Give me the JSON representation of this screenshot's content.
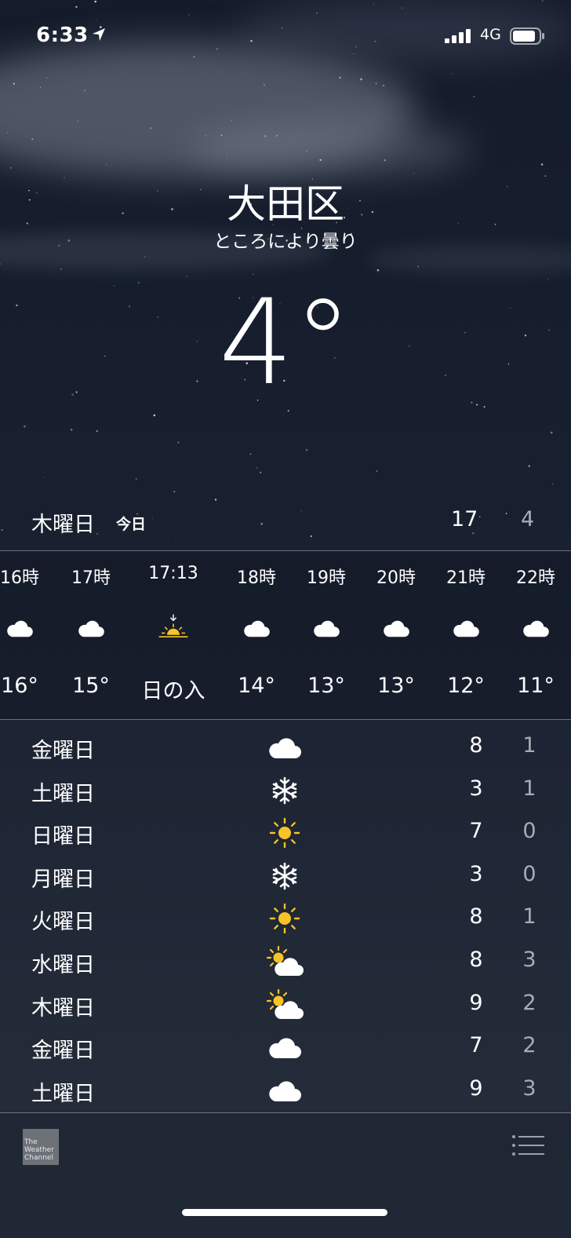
{
  "status_bar": {
    "time": "6:33",
    "network": "4G"
  },
  "location": {
    "city": "大田区",
    "condition": "ところにより曇り",
    "temperature": "4°"
  },
  "today": {
    "day": "木曜日",
    "label": "今日",
    "high": "17",
    "low": "4"
  },
  "hourly": [
    {
      "time": "16時",
      "icon": "cloud-icon",
      "value": "16°"
    },
    {
      "time": "17時",
      "icon": "cloud-icon",
      "value": "15°"
    },
    {
      "time": "17:13",
      "icon": "sunset-icon",
      "value": "日の入"
    },
    {
      "time": "18時",
      "icon": "cloud-icon",
      "value": "14°"
    },
    {
      "time": "19時",
      "icon": "cloud-icon",
      "value": "13°"
    },
    {
      "time": "20時",
      "icon": "cloud-icon",
      "value": "13°"
    },
    {
      "time": "21時",
      "icon": "cloud-icon",
      "value": "12°"
    },
    {
      "time": "22時",
      "icon": "cloud-icon",
      "value": "11°"
    }
  ],
  "daily": [
    {
      "day": "金曜日",
      "icon": "cloud-icon",
      "high": "8",
      "low": "1"
    },
    {
      "day": "土曜日",
      "icon": "snowflake-icon",
      "high": "3",
      "low": "1"
    },
    {
      "day": "日曜日",
      "icon": "sun-icon",
      "high": "7",
      "low": "0"
    },
    {
      "day": "月曜日",
      "icon": "snowflake-icon",
      "high": "3",
      "low": "0"
    },
    {
      "day": "火曜日",
      "icon": "sun-icon",
      "high": "8",
      "low": "1"
    },
    {
      "day": "水曜日",
      "icon": "partly-cloudy-icon",
      "high": "8",
      "low": "3"
    },
    {
      "day": "木曜日",
      "icon": "partly-cloudy-icon",
      "high": "9",
      "low": "2"
    },
    {
      "day": "金曜日",
      "icon": "cloud-icon",
      "high": "7",
      "low": "2"
    },
    {
      "day": "土曜日",
      "icon": "cloud-icon",
      "high": "9",
      "low": "3"
    }
  ],
  "footer": {
    "logo": [
      "The",
      "Weather",
      "Channel"
    ]
  },
  "colors": {
    "sun": "#f7c427",
    "low_temp": "#a7acb4",
    "background_top": "#141b2b",
    "background_bottom": "#272f3d"
  }
}
